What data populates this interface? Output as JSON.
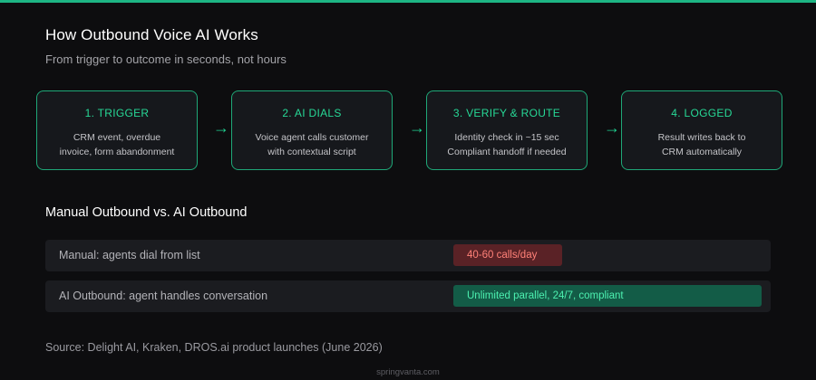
{
  "header": {
    "title": "How Outbound Voice AI Works",
    "subtitle": "From trigger to outcome in seconds, not hours"
  },
  "flow": {
    "steps": [
      {
        "title": "1. TRIGGER",
        "desc": "CRM event, overdue\ninvoice, form abandonment"
      },
      {
        "title": "2. AI DIALS",
        "desc": "Voice agent calls customer\nwith contextual script"
      },
      {
        "title": "3. VERIFY & ROUTE",
        "desc": "Identity check in ~15 sec\nCompliant handoff if needed"
      },
      {
        "title": "4. LOGGED",
        "desc": "Result writes back to\nCRM automatically"
      }
    ],
    "arrow": "→"
  },
  "comparison": {
    "title": "Manual Outbound vs. AI Outbound",
    "rows": [
      {
        "label": "Manual: agents dial from list",
        "value": "40-60 calls/day"
      },
      {
        "label": "AI Outbound: agent handles conversation",
        "value": "Unlimited parallel, 24/7, compliant"
      }
    ]
  },
  "source": "Source: Delight AI, Kraken, DROS.ai product launches (June 2026)",
  "footer": "springvanta.com",
  "colors": {
    "accent": "#1db584",
    "manual_badge_bg": "#5a2226",
    "manual_badge_text": "#ff8178",
    "ai_badge_bg": "#135c47",
    "ai_badge_text": "#4cf0b0"
  }
}
